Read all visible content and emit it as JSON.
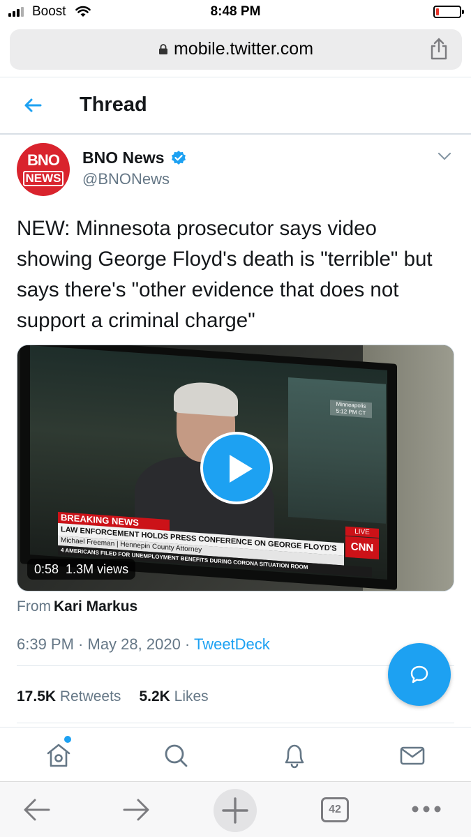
{
  "status_bar": {
    "carrier": "Boost",
    "time": "8:48 PM"
  },
  "browser": {
    "url": "mobile.twitter.com",
    "tabs_count": "42"
  },
  "header": {
    "title": "Thread"
  },
  "tweet": {
    "avatar_text_top": "BNO",
    "avatar_text_bottom": "NEWS",
    "display_name": "BNO News",
    "handle": "@BNONews",
    "text": "NEW: Minnesota prosecutor says video showing George Floyd's death is \"terrible\" but says there's \"other evidence that does not support a criminal charge\"",
    "media": {
      "duration": "0:58",
      "views": "1.3M views",
      "chyron_top": "BREAKING NEWS",
      "chyron_main": "LAW ENFORCEMENT HOLDS PRESS CONFERENCE ON GEORGE FLOYD'S DEATH",
      "chyron_sub": "Michael Freeman | Hennepin County Attorney",
      "chyron_bottom": "4 AMERICANS FILED FOR UNEMPLOYMENT BENEFITS DURING CORONA   SITUATION ROOM",
      "network": "CNN",
      "live": "LIVE",
      "location": "Minneapolis 5:12 PM CT"
    },
    "from_label": "From",
    "from_name": "Kari Markus",
    "time": "6:39 PM",
    "date": "May 28, 2020",
    "client": "TweetDeck",
    "retweets_count": "17.5K",
    "retweets_label": "Retweets",
    "likes_count": "5.2K",
    "likes_label": "Likes"
  },
  "colors": {
    "accent": "#1da1f2",
    "text": "#14171a",
    "secondary": "#657786",
    "brand_red": "#d9232d"
  }
}
